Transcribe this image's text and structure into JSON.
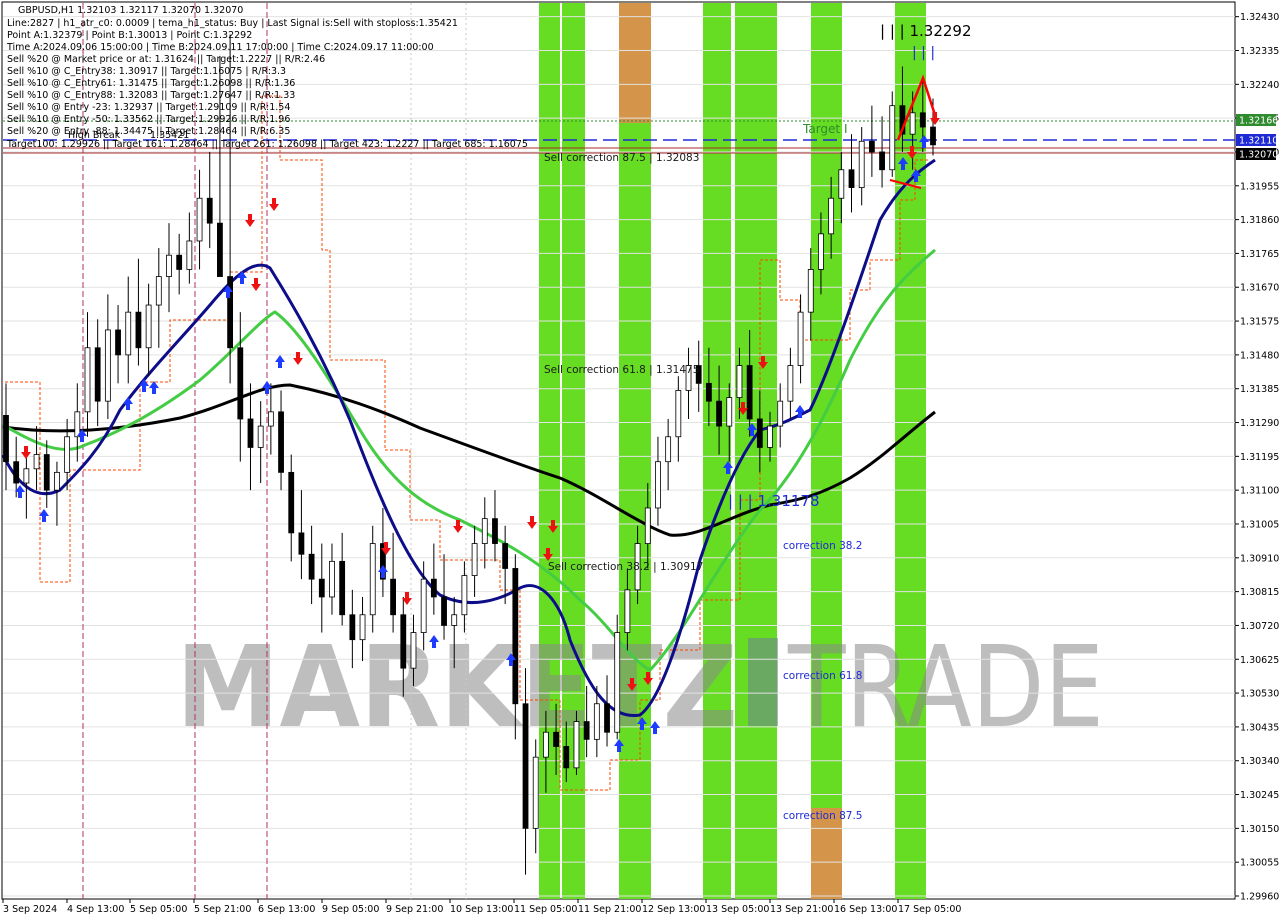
{
  "header": {
    "title": "GBPUSD,H1  1.32103 1.32117 1.32070 1.32070",
    "lines": [
      "Line:2827 | h1_atr_c0: 0.0009 | tema_h1_status: Buy | Last Signal is:Sell with stoploss:1.35421",
      "Point A:1.32379 | Point B:1.30013 | Point C:1.32292",
      "Time A:2024.09.06 15:00:00 | Time B:2024.09.11 17:00:00 | Time C:2024.09.17 11:00:00",
      "Sell %20 @ Market price or at: 1.31624 || Target:1.2227 || R/R:2.46",
      "Sell %10 @ C_Entry38: 1.30917 || Target:1.16075 | R/R:3.3",
      "Sell %10 @ C_Entry61: 1.31475 || Target:1.26098 || R/R:1.36",
      "Sell %10 @ C_Entry88: 1.32083 || Target:1.27647 || R/R:1.33",
      "Sell %10 @ Entry -23: 1.32937 || Target:1.29109 || R/R:1.54",
      "Sell %10 @ Entry -50: 1.33562 || Target:1.29926 || R/R:1.96",
      "Sell %20 @ Entry -88: 1.34475 || Target:1.28464 || R/R:6.35"
    ],
    "targets_line": "Target100: 1.29926 || Target 161: 1.28464 || Target 261: 1.26098 || Target 423: 1.2227 || Target 685: 1.16075",
    "high_break_label": "High Break",
    "high_break_value": "1.35421"
  },
  "annotations": {
    "point_c": "| | | 1.32292",
    "point_c_ticks": "| | |",
    "point_b": "| | | 1.31178",
    "target_label": "Target I",
    "sell_correction_875": "Sell correction 87.5 | 1.32083",
    "sell_correction_618": "Sell correction 61.8 | 1.31475",
    "sell_correction_382": "Sell correction 38.2 | 1.30917",
    "correction_382": "correction 38.2",
    "correction_618": "correction 61.8",
    "correction_875": "correction 87.5"
  },
  "watermark": {
    "left": "MARKETZ",
    "right": "TRADE"
  },
  "price_tags": [
    {
      "value": "1.32166",
      "color": "#2e8b2e"
    },
    {
      "value": "1.32110",
      "color": "#1f2ad6"
    },
    {
      "value": "1.32070",
      "color": "#000000"
    }
  ],
  "colors": {
    "bull_zone": "#66dd22",
    "bear_zone": "#d4944a",
    "candles": "#000000",
    "tema_fast": "#0d0d8a",
    "ma_green": "#44cc44",
    "ma_black": "#000000",
    "stop_line": "#ff4400",
    "fib_blue": "#1f2ad6",
    "fib_red": "#a52a2a",
    "buy_arrow": "#1e3cff",
    "sell_arrow": "#ee1111"
  },
  "chart_data": {
    "type": "candlestick",
    "symbol": "GBPUSD",
    "timeframe": "H1",
    "ylim": [
      1.2996,
      1.3246
    ],
    "y_ticks": [
      "1.32430",
      "1.32335",
      "1.32240",
      "1.32145",
      "1.32050",
      "1.31955",
      "1.31860",
      "1.31765",
      "1.31670",
      "1.31575",
      "1.31480",
      "1.31385",
      "1.31290",
      "1.31195",
      "1.31100",
      "1.31005",
      "1.30910",
      "1.30815",
      "1.30720",
      "1.30625",
      "1.30530",
      "1.30435",
      "1.30340",
      "1.30245",
      "1.30150",
      "1.30055",
      "1.29960"
    ],
    "x_labels": [
      "3 Sep 2024",
      "4 Sep 13:00",
      "5 Sep 05:00",
      "5 Sep 21:00",
      "6 Sep 13:00",
      "9 Sep 05:00",
      "9 Sep 21:00",
      "10 Sep 13:00",
      "11 Sep 05:00",
      "11 Sep 21:00",
      "12 Sep 13:00",
      "13 Sep 05:00",
      "13 Sep 21:00",
      "16 Sep 13:00",
      "17 Sep 05:00"
    ],
    "x_range_bars": [
      0,
      150
    ],
    "ohlc": [
      [
        1.3131,
        1.314,
        1.311,
        1.3118
      ],
      [
        1.3118,
        1.3125,
        1.3108,
        1.3112
      ],
      [
        1.3112,
        1.3122,
        1.3102,
        1.3116
      ],
      [
        1.3116,
        1.3128,
        1.311,
        1.312
      ],
      [
        1.312,
        1.3124,
        1.3105,
        1.311
      ],
      [
        1.311,
        1.3118,
        1.31,
        1.3115
      ],
      [
        1.3115,
        1.313,
        1.311,
        1.3125
      ],
      [
        1.3125,
        1.314,
        1.3118,
        1.3132
      ],
      [
        1.3132,
        1.316,
        1.3125,
        1.315
      ],
      [
        1.315,
        1.3158,
        1.3128,
        1.3135
      ],
      [
        1.3135,
        1.3165,
        1.313,
        1.3155
      ],
      [
        1.3155,
        1.3162,
        1.314,
        1.3148
      ],
      [
        1.3148,
        1.317,
        1.314,
        1.316
      ],
      [
        1.316,
        1.3175,
        1.3145,
        1.315
      ],
      [
        1.315,
        1.3168,
        1.3142,
        1.3162
      ],
      [
        1.3162,
        1.3178,
        1.315,
        1.317
      ],
      [
        1.317,
        1.3185,
        1.316,
        1.3176
      ],
      [
        1.3176,
        1.3182,
        1.3165,
        1.3172
      ],
      [
        1.3172,
        1.3188,
        1.3168,
        1.318
      ],
      [
        1.318,
        1.32,
        1.3172,
        1.3192
      ],
      [
        1.3192,
        1.3205,
        1.3178,
        1.3185
      ],
      [
        1.3185,
        1.3232,
        1.3175,
        1.317
      ],
      [
        1.317,
        1.3238,
        1.314,
        1.315
      ],
      [
        1.315,
        1.316,
        1.3118,
        1.313
      ],
      [
        1.313,
        1.314,
        1.311,
        1.3122
      ],
      [
        1.3122,
        1.3135,
        1.3112,
        1.3128
      ],
      [
        1.3128,
        1.314,
        1.312,
        1.3132
      ],
      [
        1.3132,
        1.3138,
        1.311,
        1.3115
      ],
      [
        1.3115,
        1.312,
        1.309,
        1.3098
      ],
      [
        1.3098,
        1.311,
        1.3085,
        1.3092
      ],
      [
        1.3092,
        1.31,
        1.3078,
        1.3085
      ],
      [
        1.3085,
        1.3095,
        1.307,
        1.308
      ],
      [
        1.308,
        1.3095,
        1.3075,
        1.309
      ],
      [
        1.309,
        1.3098,
        1.3072,
        1.3075
      ],
      [
        1.3075,
        1.3082,
        1.306,
        1.3068
      ],
      [
        1.3068,
        1.308,
        1.3062,
        1.3075
      ],
      [
        1.3075,
        1.31,
        1.307,
        1.3095
      ],
      [
        1.3095,
        1.3105,
        1.308,
        1.3085
      ],
      [
        1.3085,
        1.3098,
        1.307,
        1.3075
      ],
      [
        1.3075,
        1.308,
        1.3052,
        1.306
      ],
      [
        1.306,
        1.3075,
        1.3055,
        1.307
      ],
      [
        1.307,
        1.309,
        1.3065,
        1.3085
      ],
      [
        1.3085,
        1.3095,
        1.3075,
        1.308
      ],
      [
        1.308,
        1.3092,
        1.3068,
        1.3072
      ],
      [
        1.3072,
        1.308,
        1.306,
        1.3075
      ],
      [
        1.3075,
        1.309,
        1.307,
        1.3086
      ],
      [
        1.3086,
        1.31,
        1.308,
        1.3095
      ],
      [
        1.3095,
        1.3108,
        1.3088,
        1.3102
      ],
      [
        1.3102,
        1.311,
        1.309,
        1.3095
      ],
      [
        1.3095,
        1.31,
        1.3078,
        1.3088
      ],
      [
        1.3088,
        1.3092,
        1.304,
        1.305
      ],
      [
        1.305,
        1.306,
        1.3002,
        1.3015
      ],
      [
        1.3015,
        1.304,
        1.3008,
        1.3035
      ],
      [
        1.3035,
        1.3048,
        1.3025,
        1.3042
      ],
      [
        1.3042,
        1.305,
        1.303,
        1.3038
      ],
      [
        1.3038,
        1.3045,
        1.3028,
        1.3032
      ],
      [
        1.3032,
        1.3048,
        1.303,
        1.3045
      ],
      [
        1.3045,
        1.3055,
        1.3035,
        1.304
      ],
      [
        1.304,
        1.3055,
        1.3035,
        1.305
      ],
      [
        1.305,
        1.3058,
        1.3038,
        1.3042
      ],
      [
        1.3042,
        1.3075,
        1.304,
        1.307
      ],
      [
        1.307,
        1.3088,
        1.3065,
        1.3082
      ],
      [
        1.3082,
        1.31,
        1.3078,
        1.3095
      ],
      [
        1.3095,
        1.3112,
        1.3088,
        1.3105
      ],
      [
        1.3105,
        1.3125,
        1.31,
        1.3118
      ],
      [
        1.3118,
        1.313,
        1.311,
        1.3125
      ],
      [
        1.3125,
        1.3142,
        1.3118,
        1.3138
      ],
      [
        1.3138,
        1.315,
        1.313,
        1.3145
      ],
      [
        1.3145,
        1.3152,
        1.3132,
        1.314
      ],
      [
        1.314,
        1.315,
        1.3128,
        1.3135
      ],
      [
        1.3135,
        1.3145,
        1.312,
        1.3128
      ],
      [
        1.3128,
        1.314,
        1.3118,
        1.3136
      ],
      [
        1.3136,
        1.315,
        1.313,
        1.3145
      ],
      [
        1.3145,
        1.3155,
        1.3125,
        1.313
      ],
      [
        1.313,
        1.3138,
        1.3115,
        1.3122
      ],
      [
        1.3122,
        1.3132,
        1.3118,
        1.3128
      ],
      [
        1.3128,
        1.314,
        1.3122,
        1.3135
      ],
      [
        1.3135,
        1.315,
        1.313,
        1.3145
      ],
      [
        1.3145,
        1.3165,
        1.314,
        1.316
      ],
      [
        1.316,
        1.3178,
        1.3152,
        1.3172
      ],
      [
        1.3172,
        1.3188,
        1.3165,
        1.3182
      ],
      [
        1.3182,
        1.3198,
        1.3175,
        1.3192
      ],
      [
        1.3192,
        1.3205,
        1.3185,
        1.32
      ],
      [
        1.32,
        1.321,
        1.3188,
        1.3195
      ],
      [
        1.3195,
        1.3212,
        1.319,
        1.3208
      ],
      [
        1.3208,
        1.3218,
        1.3198,
        1.3205
      ],
      [
        1.3205,
        1.3215,
        1.3195,
        1.32
      ],
      [
        1.32,
        1.3222,
        1.3198,
        1.3218
      ],
      [
        1.3218,
        1.3229,
        1.3205,
        1.321
      ],
      [
        1.321,
        1.3222,
        1.32,
        1.3216
      ],
      [
        1.3216,
        1.3225,
        1.3205,
        1.3212
      ],
      [
        1.3212,
        1.322,
        1.3204,
        1.3207
      ]
    ]
  }
}
